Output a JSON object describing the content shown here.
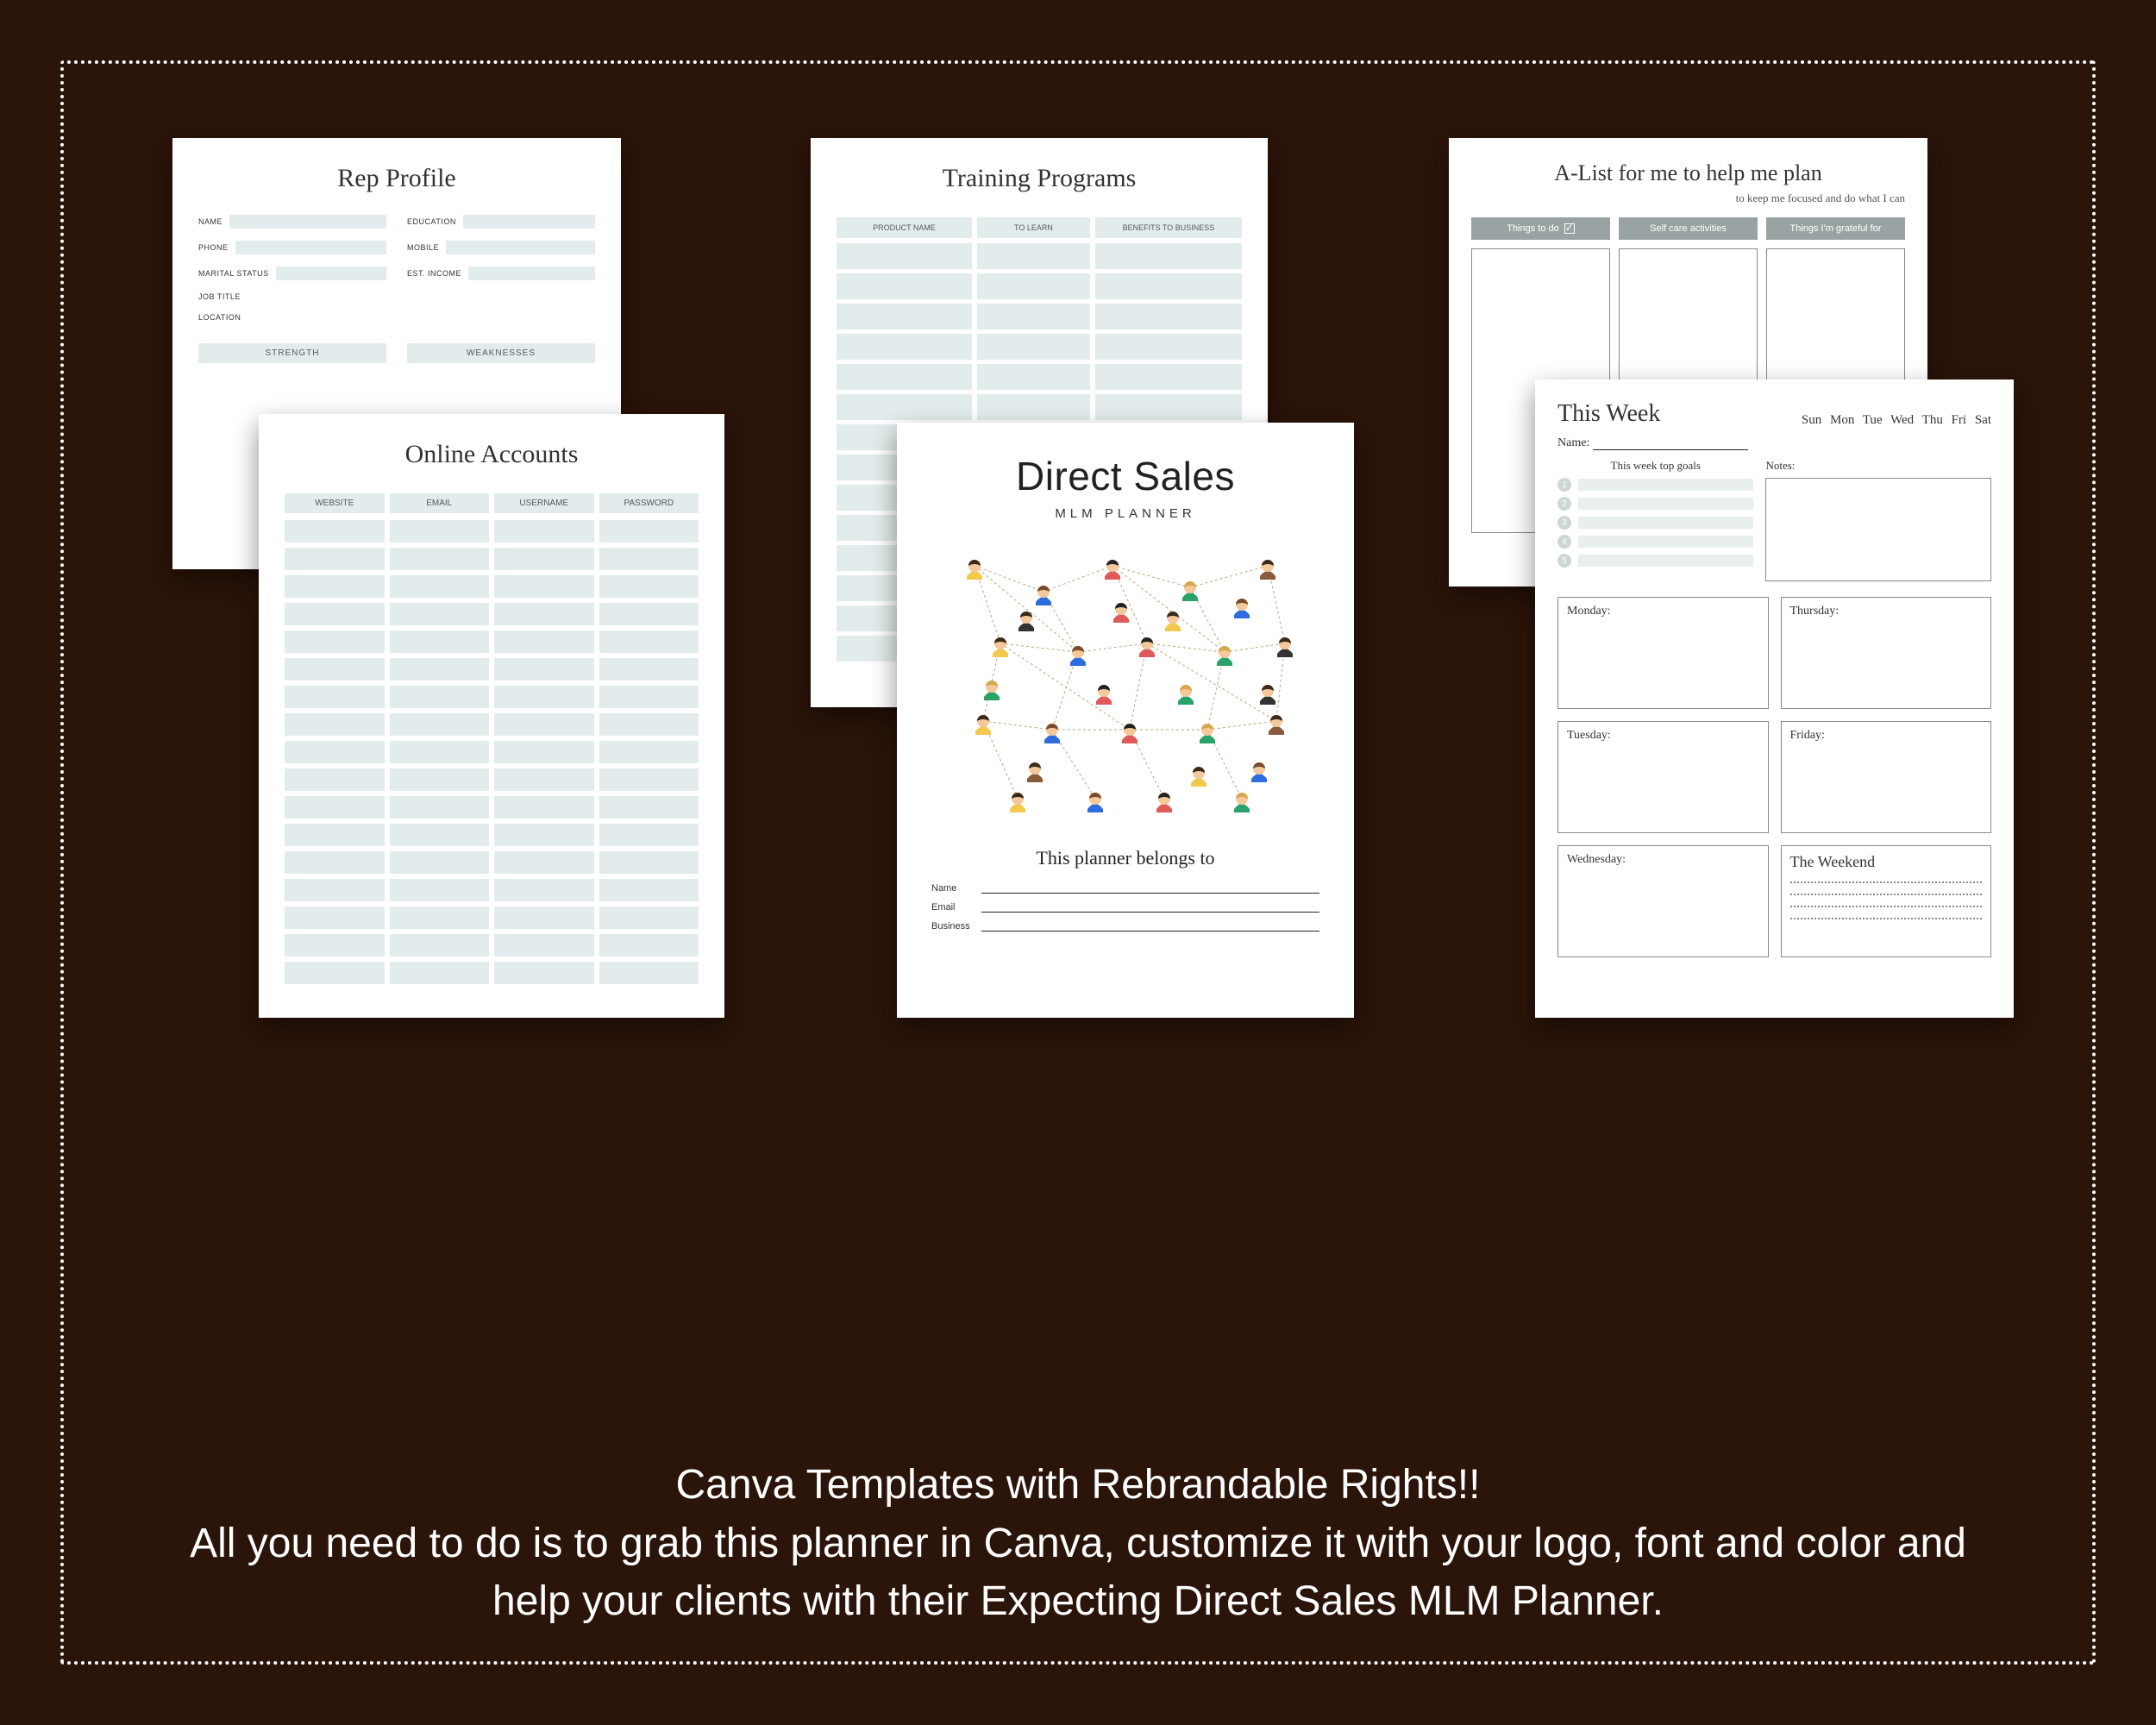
{
  "rep_profile": {
    "title": "Rep Profile",
    "fields_left": [
      "NAME",
      "PHONE",
      "MARITAL STATUS",
      "JOB TITLE",
      "LOCATION"
    ],
    "fields_right": [
      "EDUCATION",
      "MOBILE",
      "EST. INCOME"
    ],
    "col_headers": [
      "STRENGTH",
      "WEAKNESSES"
    ]
  },
  "online_accounts": {
    "title": "Online Accounts",
    "headers": [
      "WEBSITE",
      "EMAIL",
      "USERNAME",
      "PASSWORD"
    ],
    "row_count": 17
  },
  "training": {
    "title": "Training Programs",
    "headers": [
      "PRODUCT NAME",
      "TO LEARN",
      "BENEFITS TO BUSINESS"
    ],
    "row_count": 14
  },
  "cover": {
    "title": "Direct Sales",
    "subtitle": "MLM PLANNER",
    "belongs": "This planner belongs to",
    "lines": [
      "Name",
      "Email",
      "Business"
    ]
  },
  "alist": {
    "title": "A-List for me to help me plan",
    "tagline": "to keep me focused  and do what I can",
    "cols": [
      "Things to do",
      "Self care activities",
      "Things I'm grateful for"
    ]
  },
  "week": {
    "title": "This Week",
    "days": "Sun   Mon  Tue   Wed   Thu  Fri  Sat",
    "name_label": "Name:",
    "goals_title": "This week top goals",
    "notes_title": "Notes:",
    "goal_count": 5,
    "day_labels": [
      "Monday:",
      "Thursday:",
      "Tuesday:",
      "Friday:",
      "Wednesday:"
    ],
    "weekend_title": "The Weekend"
  },
  "marketing": {
    "line1": "Canva Templates with Rebrandable Rights!!",
    "line2": "All you need to do is to grab this planner in Canva, customize it with your logo, font and color and help your clients with their Expecting Direct Sales MLM Planner."
  }
}
